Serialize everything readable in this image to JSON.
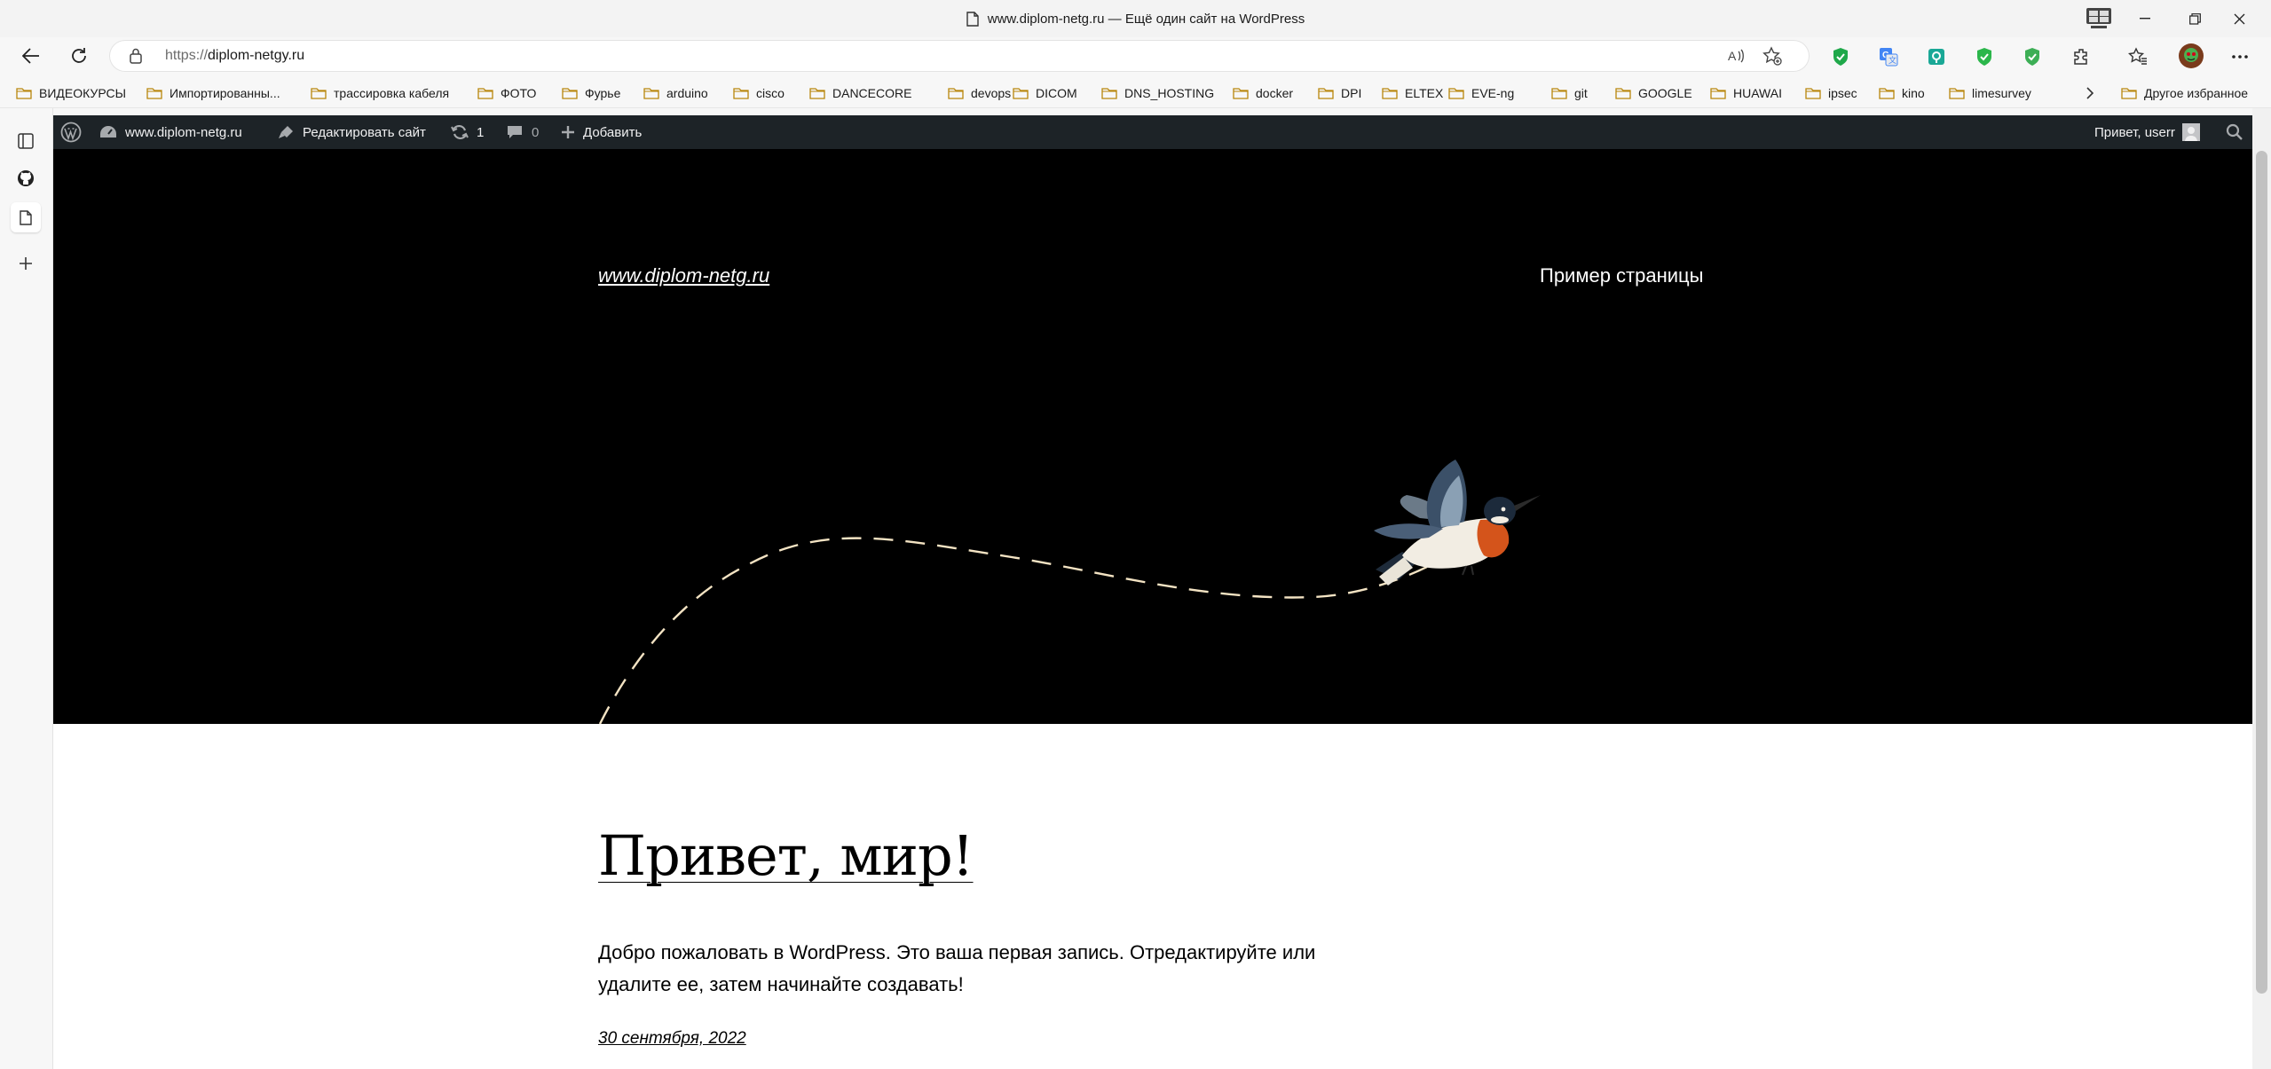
{
  "window": {
    "title": "www.diplom-netg.ru — Ещё один сайт на WordPress"
  },
  "toolbar": {
    "url_scheme": "https://",
    "url_host": "diplom-netgy.ru"
  },
  "bookmarks": [
    "ВИДЕОКУРСЫ",
    "Импортированны...",
    "трассировка кабеля",
    "ФОТО",
    "Фурье",
    "arduino",
    "cisco",
    "DANCECORE",
    "devops",
    "DICOM",
    "DNS_HOSTING",
    "docker",
    "DPI",
    "ELTEX",
    "EVE-ng",
    "git",
    "GOOGLE",
    "HUAWAI",
    "ipsec",
    "kino",
    "limesurvey"
  ],
  "bookmarks_other": "Другое избранное",
  "wp_admin_bar": {
    "site_name": "www.diplom-netg.ru",
    "edit_site": "Редактировать сайт",
    "updates_count": "1",
    "comments_count": "0",
    "add_new": "Добавить",
    "greeting": "Привет, userr"
  },
  "site": {
    "title": "www.diplom-netg.ru",
    "nav_page": "Пример страницы"
  },
  "post": {
    "title": "Привет, мир!",
    "body": "Добро пожаловать в WordPress. Это ваша первая запись. Отредактируйте или удалите ее, затем начинайте создавать!",
    "date": "30 сентября, 2022"
  },
  "colors": {
    "wp_admin_bg": "#1d2327",
    "hero_bg": "#000000",
    "dash_line": "#f3e3c3"
  }
}
